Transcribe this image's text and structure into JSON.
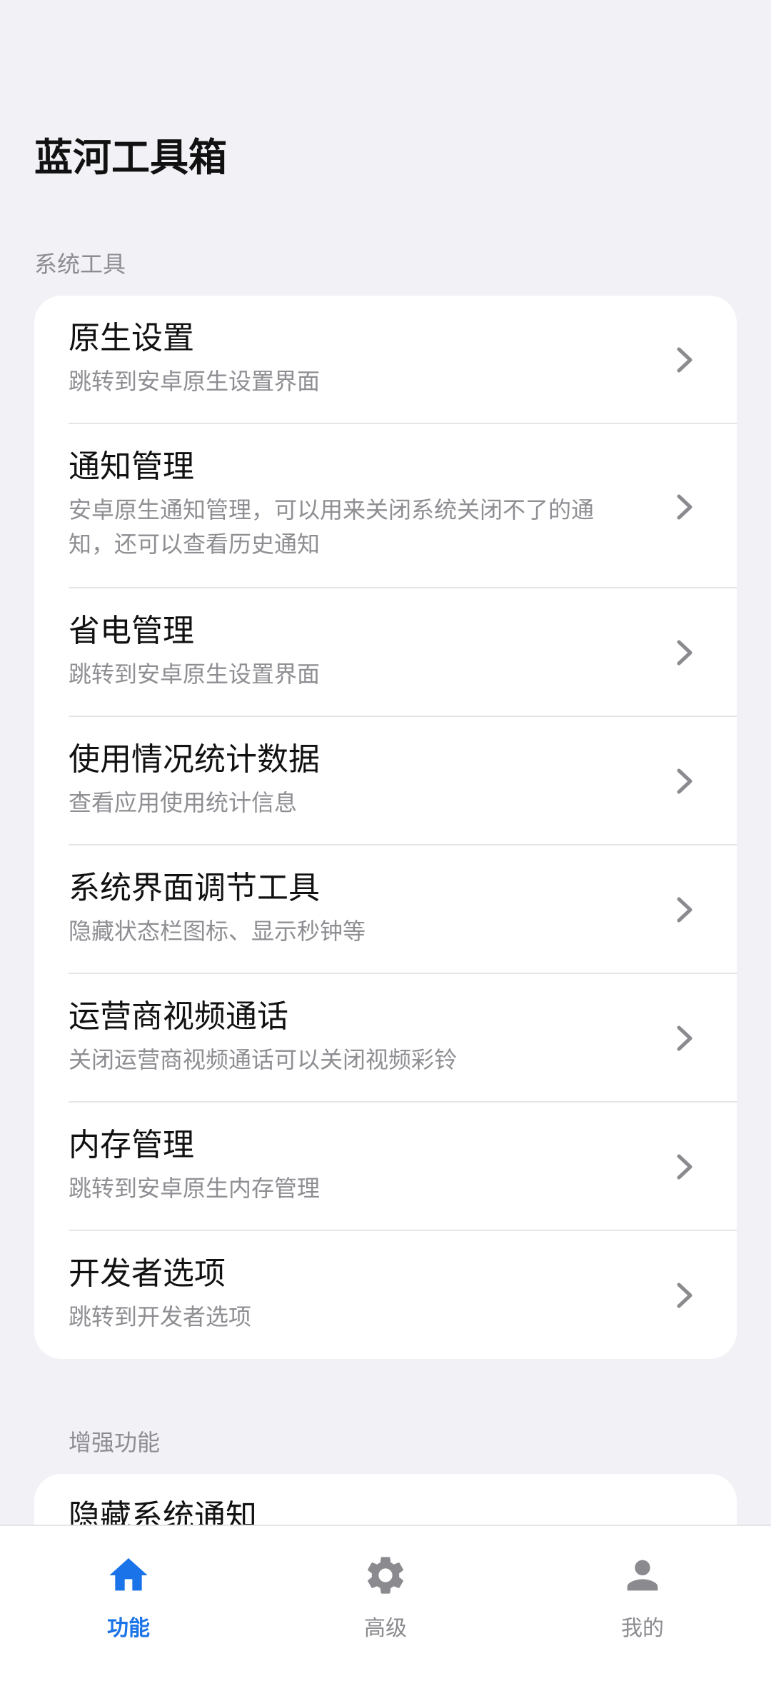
{
  "header": {
    "title": "蓝河工具箱"
  },
  "sections": [
    {
      "label": "系统工具",
      "items": [
        {
          "title": "原生设置",
          "subtitle": "跳转到安卓原生设置界面"
        },
        {
          "title": "通知管理",
          "subtitle": "安卓原生通知管理，可以用来关闭系统关闭不了的通知，还可以查看历史通知"
        },
        {
          "title": "省电管理",
          "subtitle": "跳转到安卓原生设置界面"
        },
        {
          "title": "使用情况统计数据",
          "subtitle": "查看应用使用统计信息"
        },
        {
          "title": "系统界面调节工具",
          "subtitle": "隐藏状态栏图标、显示秒钟等"
        },
        {
          "title": "运营商视频通话",
          "subtitle": "关闭运营商视频通话可以关闭视频彩铃"
        },
        {
          "title": "内存管理",
          "subtitle": "跳转到安卓原生内存管理"
        },
        {
          "title": "开发者选项",
          "subtitle": "跳转到开发者选项"
        }
      ]
    },
    {
      "label": "增强功能",
      "items": [
        {
          "title": "隐藏系统通知"
        }
      ]
    }
  ],
  "bottom_nav": {
    "items": [
      {
        "label": "功能",
        "icon": "home-icon",
        "active": true
      },
      {
        "label": "高级",
        "icon": "gear-icon",
        "active": false
      },
      {
        "label": "我的",
        "icon": "person-icon",
        "active": false
      }
    ]
  },
  "colors": {
    "accent": "#1a73e8",
    "inactive": "#8a8a8f",
    "background": "#f1f1f6",
    "card": "#ffffff"
  }
}
